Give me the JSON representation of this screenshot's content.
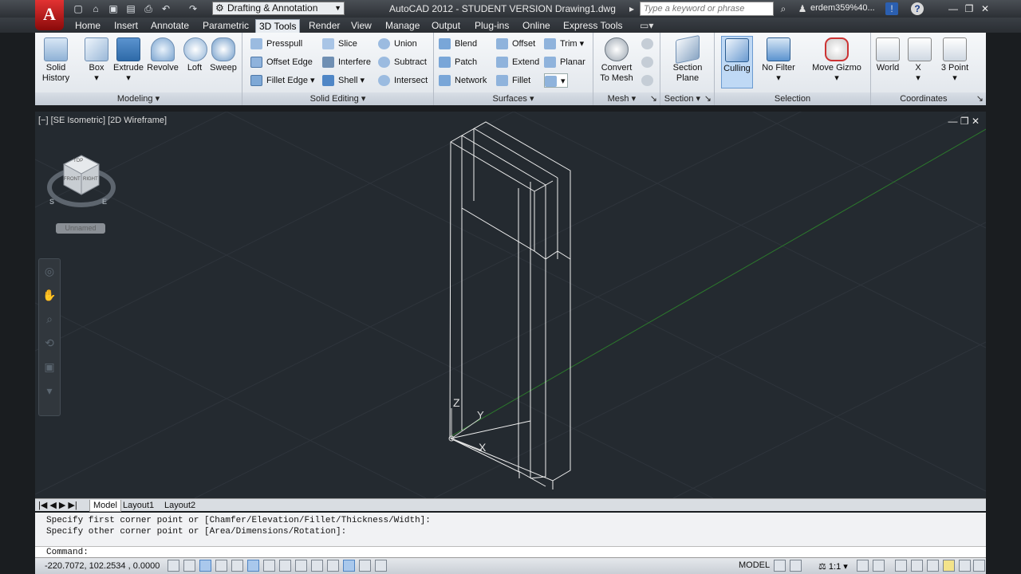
{
  "title": {
    "app_letter": "A",
    "workspace": "Drafting & Annotation",
    "window_title": "AutoCAD 2012 - STUDENT VERSION    Drawing1.dwg",
    "search_placeholder": "Type a keyword or phrase",
    "user": "erdem359%40..."
  },
  "tabs": [
    "Home",
    "Insert",
    "Annotate",
    "Parametric",
    "3D Tools",
    "Render",
    "View",
    "Manage",
    "Output",
    "Plug-ins",
    "Online",
    "Express Tools"
  ],
  "active_tab": "3D Tools",
  "ribbon": {
    "modeling": {
      "title": "Modeling",
      "solid_history": "Solid\nHistory",
      "box": "Box",
      "extrude": "Extrude",
      "revolve": "Revolve",
      "loft": "Loft",
      "sweep": "Sweep"
    },
    "solid_editing": {
      "title": "Solid Editing",
      "presspull": "Presspull",
      "offset_edge": "Offset Edge",
      "fillet_edge": "Fillet Edge",
      "slice": "Slice",
      "interfere": "Interfere",
      "shell": "Shell",
      "union": "Union",
      "subtract": "Subtract",
      "intersect": "Intersect"
    },
    "surfaces": {
      "title": "Surfaces",
      "blend": "Blend",
      "patch": "Patch",
      "network": "Network",
      "offset": "Offset",
      "extend": "Extend",
      "fillet": "Fillet",
      "trim": "Trim",
      "planar": "Planar"
    },
    "mesh": {
      "title": "Mesh",
      "convert_to_mesh": "Convert\nTo Mesh"
    },
    "section": {
      "title": "Section",
      "section_plane": "Section\nPlane"
    },
    "selection": {
      "title": "Selection",
      "culling": "Culling",
      "no_filter": "No Filter",
      "move_gizmo": "Move Gizmo"
    },
    "coordinates": {
      "title": "Coordinates",
      "world": "World",
      "x": "X",
      "three_point": "3 Point"
    }
  },
  "viewport": {
    "label": "[−] [SE Isometric] [2D Wireframe]",
    "ucs_unnamed": "Unnamed",
    "viewcube": {
      "top": "TOP",
      "front": "FRONT",
      "right": "RIGHT",
      "s": "S",
      "e": "E"
    },
    "ucs_z": "Z",
    "ucs_y": "Y",
    "ucs_x": "X"
  },
  "layout_tabs": [
    "Model",
    "Layout1",
    "Layout2"
  ],
  "command": {
    "line1": "Specify first corner point or [Chamfer/Elevation/Fillet/Thickness/Width]:",
    "line2": "Specify other corner point or [Area/Dimensions/Rotation]:",
    "prompt": "Command:"
  },
  "status": {
    "coords": "-220.7072, 102.2534 , 0.0000",
    "model": "MODEL",
    "scale": "1:1"
  }
}
